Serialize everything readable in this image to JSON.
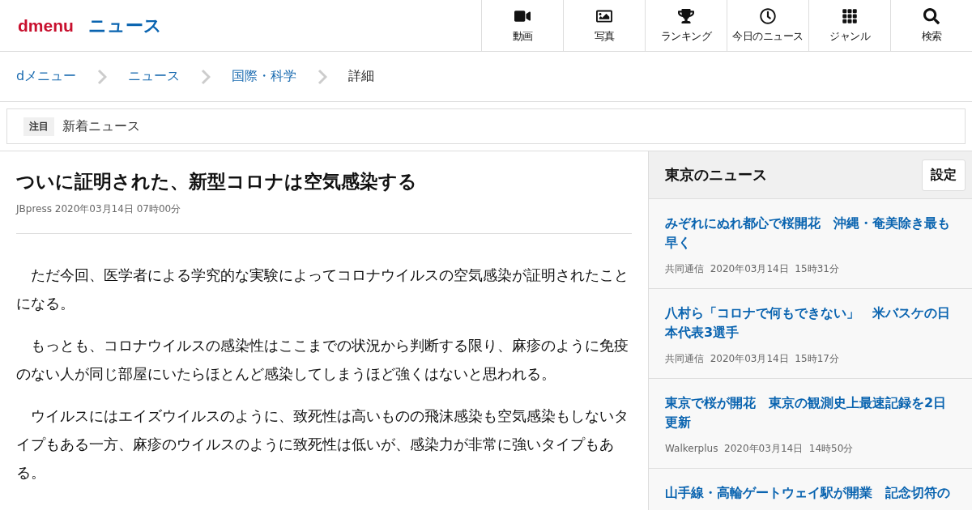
{
  "header": {
    "logo": "dmenu",
    "section": "ニュース",
    "nav": [
      {
        "kind": "video",
        "label": "動画"
      },
      {
        "kind": "photo",
        "label": "写真"
      },
      {
        "kind": "trophy",
        "label": "ランキング"
      },
      {
        "kind": "clock",
        "label": "今日のニュース"
      },
      {
        "kind": "grid",
        "label": "ジャンル"
      },
      {
        "kind": "search",
        "label": "検索"
      }
    ]
  },
  "breadcrumbs": [
    {
      "label": "dメニュー",
      "link": true
    },
    {
      "label": "ニュース",
      "link": true
    },
    {
      "label": "国際・科学",
      "link": true
    },
    {
      "label": "詳細",
      "link": false
    }
  ],
  "notice": {
    "tag": "注目",
    "text": "新着ニュース"
  },
  "article": {
    "title": "ついに証明された、新型コロナは空気感染する",
    "source": "JBpress",
    "date": "2020年03月14日",
    "time": "07時00分",
    "paragraphs": [
      "　ただ今回、医学者による学究的な実験によってコロナウイルスの空気感染が証明されたことになる。",
      "　もっとも、コロナウイルスの感染性はここまでの状況から判断する限り、麻疹のように免疫のない人が同じ部屋にいたらほとんど感染してしまうほど強くはないと思われる。",
      "　ウイルスにはエイズウイルスのように、致死性は高いものの飛沫感染も空気感染もしないタイプもある一方、麻疹のウイルスのように致死性は低いが、感染力が非常に強いタイプもある。"
    ]
  },
  "sidebar": {
    "title": "東京のニュース",
    "button": "設定",
    "items": [
      {
        "title": "みぞれにぬれ都心で桜開花　沖縄・奄美除き最も早く",
        "source": "共同通信",
        "date": "2020年03月14日",
        "time": "15時31分"
      },
      {
        "title": "八村ら「コロナで何もできない」　米バスケの日本代表3選手",
        "source": "共同通信",
        "date": "2020年03月14日",
        "time": "15時17分"
      },
      {
        "title": "東京で桜が開花　東京の観測史上最速記録を2日更新",
        "source": "Walkerplus",
        "date": "2020年03月14日",
        "time": "14時50分"
      },
      {
        "title": "山手線・高輪ゲートウェイ駅が開業　記念切符の"
      }
    ]
  }
}
